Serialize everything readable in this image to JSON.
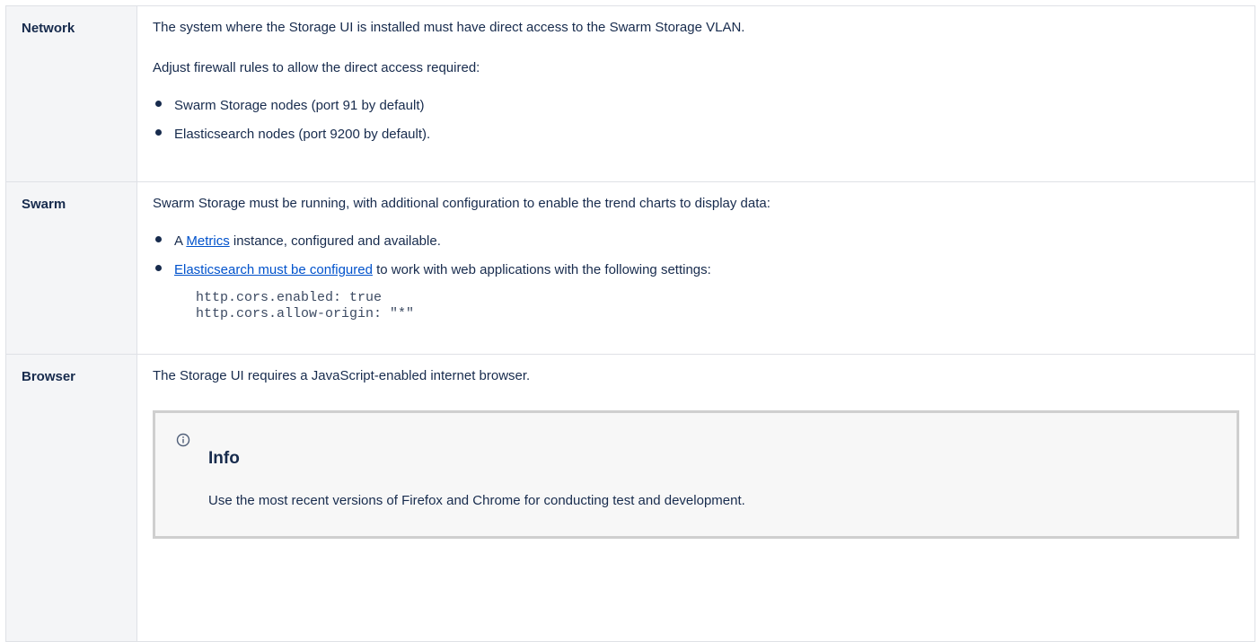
{
  "rows": {
    "network": {
      "label": "Network",
      "paragraph1": "The system where the Storage UI is installed must have direct access to the Swarm Storage VLAN.",
      "paragraph2": "Adjust firewall rules to allow the direct access required:",
      "bullets": [
        "Swarm Storage nodes (port 91 by default)",
        "Elasticsearch nodes (port 9200 by default)."
      ]
    },
    "swarm": {
      "label": "Swarm",
      "paragraph1": "Swarm Storage must be running, with additional configuration to enable the trend charts to display data:",
      "bullet1_prefix": "A ",
      "bullet1_link": "Metrics",
      "bullet1_suffix": " instance, configured and available.",
      "bullet2_link": "Elasticsearch must be configured",
      "bullet2_suffix": " to work with web applications with the following settings:",
      "code_lines": [
        "http.cors.enabled: true",
        "http.cors.allow-origin: \"*\""
      ]
    },
    "browser": {
      "label": "Browser",
      "paragraph1": "The Storage UI requires a JavaScript-enabled internet browser.",
      "info": {
        "icon": "info-circle-icon",
        "title": "Info",
        "body": "Use the most recent versions of Firefox and Chrome for conducting test and development."
      }
    }
  },
  "colors": {
    "text": "#172b4d",
    "link": "#0052cc",
    "label_bg": "#f4f5f7",
    "border": "#dfe1e6",
    "panel_border": "#cfcfcf",
    "panel_bg": "#f7f7f7"
  }
}
